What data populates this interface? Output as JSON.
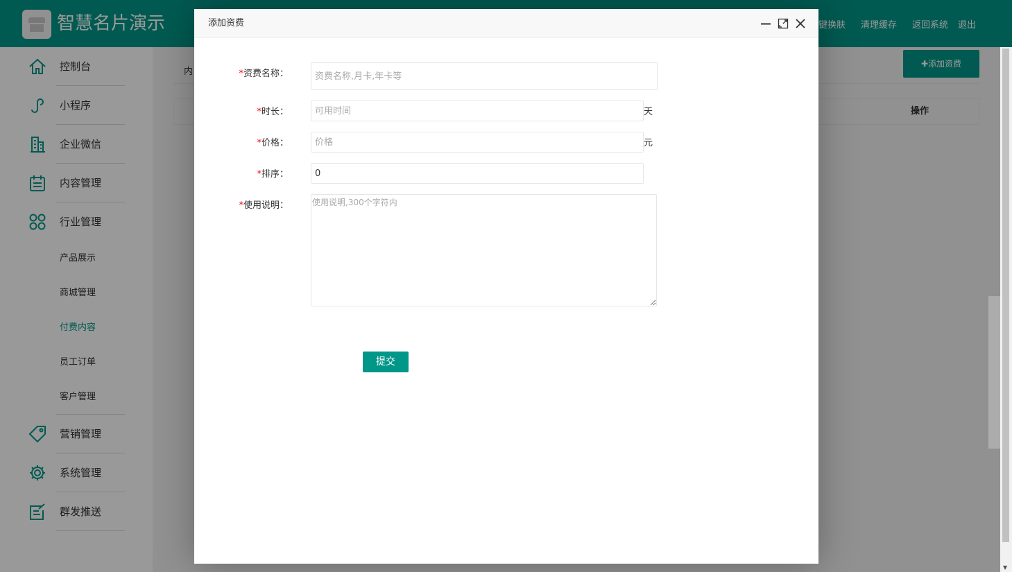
{
  "header": {
    "brand": "智慧名片演示",
    "nav": [
      "键换肤",
      "清理缓存",
      "返回系统",
      "退出"
    ],
    "bg_color": "#009688"
  },
  "sidebar": {
    "items": [
      {
        "label": "控制台",
        "icon": "home-icon"
      },
      {
        "label": "小程序",
        "icon": "mini-program-icon"
      },
      {
        "label": "企业微信",
        "icon": "building-icon"
      },
      {
        "label": "内容管理",
        "icon": "clipboard-icon"
      },
      {
        "label": "行业管理",
        "icon": "clover-icon"
      },
      {
        "label": "营销管理",
        "icon": "tag-icon"
      },
      {
        "label": "系统管理",
        "icon": "gear-icon"
      },
      {
        "label": "群发推送",
        "icon": "edit-icon"
      }
    ],
    "sub_items": [
      {
        "label": "产品展示"
      },
      {
        "label": "商城管理"
      },
      {
        "label": "付费内容",
        "active": true
      },
      {
        "label": "员工订单"
      },
      {
        "label": "客户管理"
      }
    ]
  },
  "content": {
    "crumb": "内",
    "add_button": "✚添加资费",
    "table_op_header": "操作"
  },
  "modal": {
    "title": "添加资费",
    "fields": {
      "name": {
        "label": "资费名称：",
        "placeholder": "资费名称,月卡,年卡等",
        "value": ""
      },
      "duration": {
        "label": "时长：",
        "placeholder": "可用时间",
        "value": "",
        "unit": "天"
      },
      "price": {
        "label": "价格：",
        "placeholder": "价格",
        "value": "",
        "unit": "元"
      },
      "sort": {
        "label": "排序：",
        "placeholder": "",
        "value": "0"
      },
      "desc": {
        "label": "使用说明：",
        "placeholder": "使用说明,300个字符内",
        "value": ""
      }
    },
    "required_mark": "*",
    "submit_label": "提交"
  }
}
